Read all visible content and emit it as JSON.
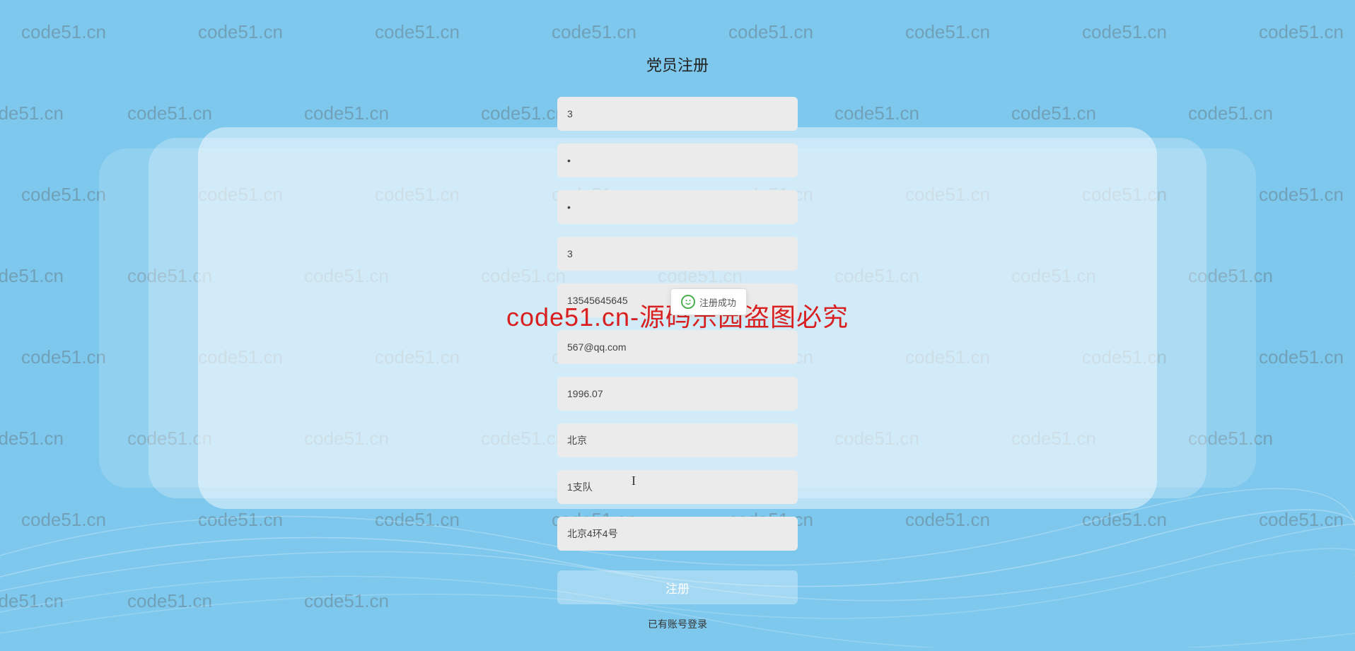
{
  "watermark_text": "code51.cn",
  "form": {
    "title": "党员注册",
    "fields": {
      "username": "3",
      "password": "•",
      "confirm_password": "•",
      "id_number": "3",
      "phone": "13545645645",
      "email": "567@qq.com",
      "birth_date": "1996.07",
      "city": "北京",
      "branch": "1支队",
      "address": "北京4环4号"
    },
    "submit_label": "注册",
    "login_link_label": "已有账号登录"
  },
  "tooltip": {
    "text": "注册成功"
  },
  "red_watermark": "code51.cn-源码乐园盗图必究"
}
